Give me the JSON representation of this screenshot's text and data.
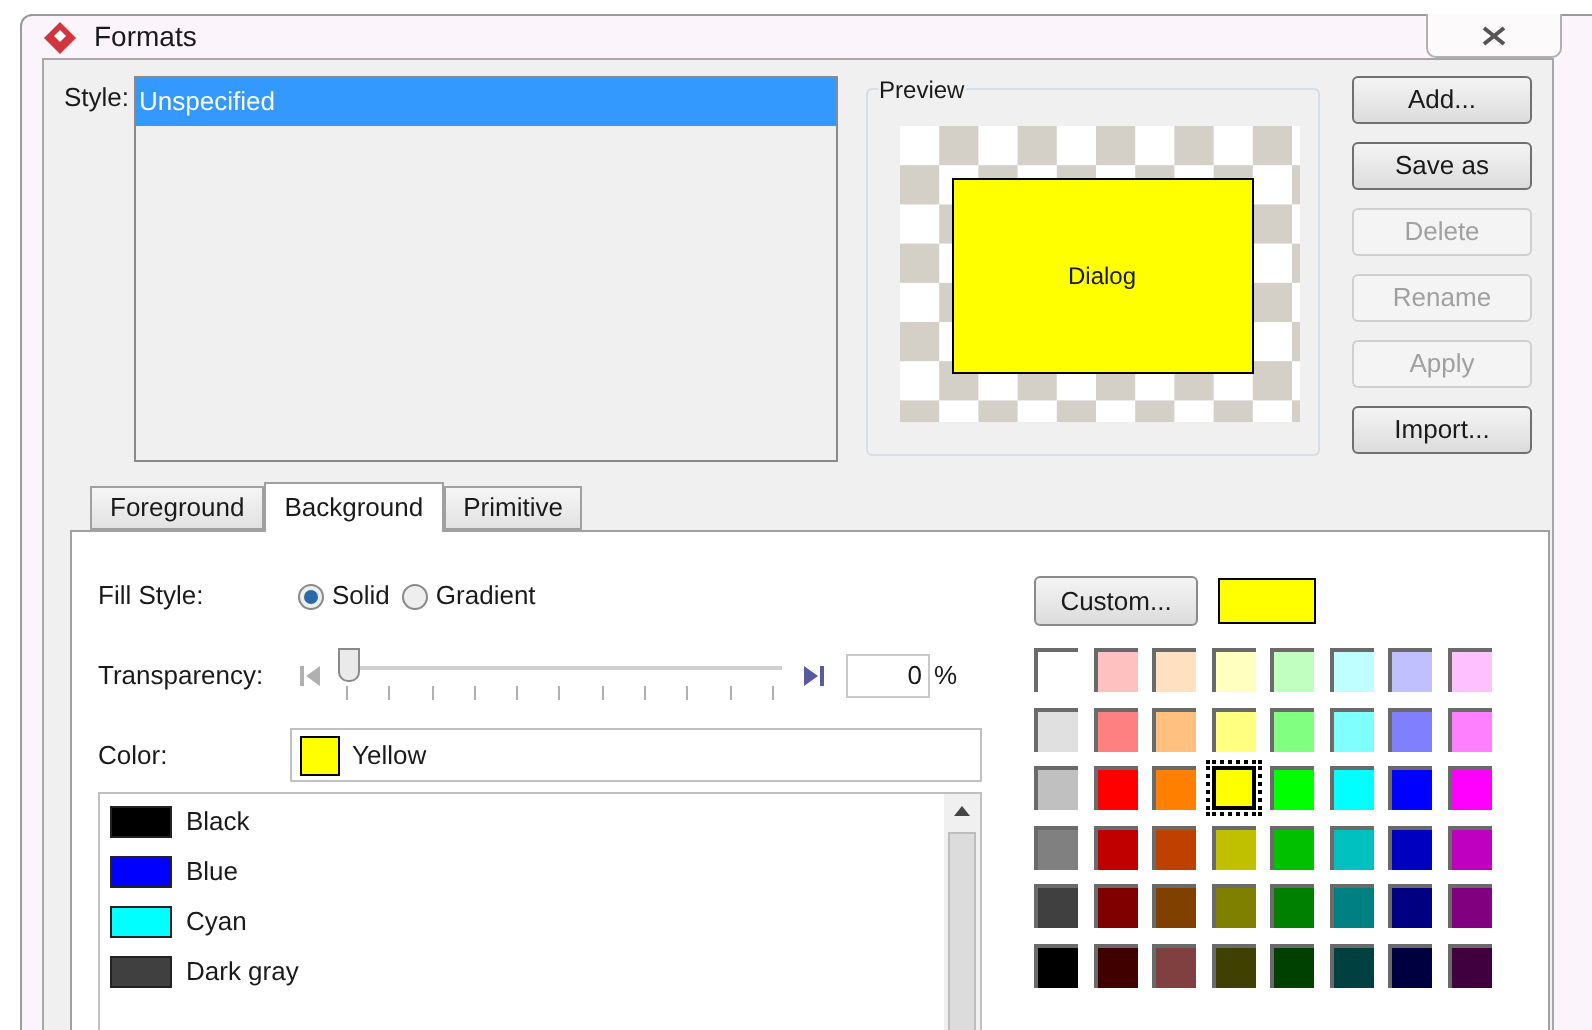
{
  "window": {
    "title": "Formats"
  },
  "style": {
    "label": "Style:",
    "items": [
      {
        "label": "Unspecified",
        "selected": true
      }
    ]
  },
  "preview": {
    "title": "Preview",
    "shape_label": "Dialog"
  },
  "buttons": [
    {
      "label": "Add...",
      "disabled": false
    },
    {
      "label": "Save as",
      "disabled": false
    },
    {
      "label": "Delete",
      "disabled": true
    },
    {
      "label": "Rename",
      "disabled": true
    },
    {
      "label": "Apply",
      "disabled": true
    },
    {
      "label": "Import...",
      "disabled": false
    }
  ],
  "tabs": [
    {
      "label": "Foreground",
      "selected": false
    },
    {
      "label": "Background",
      "selected": true
    },
    {
      "label": "Primitive",
      "selected": false
    }
  ],
  "fill_style": {
    "label": "Fill Style:",
    "options": [
      {
        "label": "Solid",
        "selected": true
      },
      {
        "label": "Gradient",
        "selected": false
      }
    ]
  },
  "transparency": {
    "label": "Transparency:",
    "level": 0,
    "value": "0",
    "unit": "%"
  },
  "color": {
    "label": "Color:",
    "value": "Yellow",
    "color": "#ffff00"
  },
  "color_list": [
    {
      "label": "Black",
      "color": "#000000"
    },
    {
      "label": "Blue",
      "color": "#0000ff"
    },
    {
      "label": "Cyan",
      "color": "#00ffff"
    },
    {
      "label": "Dark gray",
      "color": "#404040"
    }
  ],
  "custom_button": {
    "label": "Custom...",
    "color": "#ffff00"
  },
  "palette": [
    [
      {
        "color": "#ffffff",
        "selected": false
      },
      {
        "color": "#ffc0c0",
        "selected": false
      },
      {
        "color": "#ffe0c0",
        "selected": false
      },
      {
        "color": "#ffffc0",
        "selected": false
      },
      {
        "color": "#c0ffc0",
        "selected": false
      },
      {
        "color": "#c0ffff",
        "selected": false
      },
      {
        "color": "#c0c0ff",
        "selected": false
      },
      {
        "color": "#ffc0ff",
        "selected": false
      }
    ],
    [
      {
        "color": "#e0e0e0",
        "selected": false
      },
      {
        "color": "#ff8080",
        "selected": false
      },
      {
        "color": "#ffc080",
        "selected": false
      },
      {
        "color": "#ffff80",
        "selected": false
      },
      {
        "color": "#80ff80",
        "selected": false
      },
      {
        "color": "#80ffff",
        "selected": false
      },
      {
        "color": "#8080ff",
        "selected": false
      },
      {
        "color": "#ff80ff",
        "selected": false
      }
    ],
    [
      {
        "color": "#c0c0c0",
        "selected": false
      },
      {
        "color": "#ff0000",
        "selected": false
      },
      {
        "color": "#ff8000",
        "selected": false
      },
      {
        "color": "#ffff00",
        "selected": true
      },
      {
        "color": "#00ff00",
        "selected": false
      },
      {
        "color": "#00ffff",
        "selected": false
      },
      {
        "color": "#0000ff",
        "selected": false
      },
      {
        "color": "#ff00ff",
        "selected": false
      }
    ],
    [
      {
        "color": "#808080",
        "selected": false
      },
      {
        "color": "#c00000",
        "selected": false
      },
      {
        "color": "#c04000",
        "selected": false
      },
      {
        "color": "#c0c000",
        "selected": false
      },
      {
        "color": "#00c000",
        "selected": false
      },
      {
        "color": "#00c0c0",
        "selected": false
      },
      {
        "color": "#0000c0",
        "selected": false
      },
      {
        "color": "#c000c0",
        "selected": false
      }
    ],
    [
      {
        "color": "#404040",
        "selected": false
      },
      {
        "color": "#800000",
        "selected": false
      },
      {
        "color": "#804000",
        "selected": false
      },
      {
        "color": "#808000",
        "selected": false
      },
      {
        "color": "#008000",
        "selected": false
      },
      {
        "color": "#008080",
        "selected": false
      },
      {
        "color": "#000080",
        "selected": false
      },
      {
        "color": "#800080",
        "selected": false
      }
    ],
    [
      {
        "color": "#000000",
        "selected": false
      },
      {
        "color": "#400000",
        "selected": false
      },
      {
        "color": "#804040",
        "selected": false
      },
      {
        "color": "#404000",
        "selected": false
      },
      {
        "color": "#004000",
        "selected": false
      },
      {
        "color": "#004040",
        "selected": false
      },
      {
        "color": "#000040",
        "selected": false
      },
      {
        "color": "#400040",
        "selected": false
      }
    ]
  ]
}
